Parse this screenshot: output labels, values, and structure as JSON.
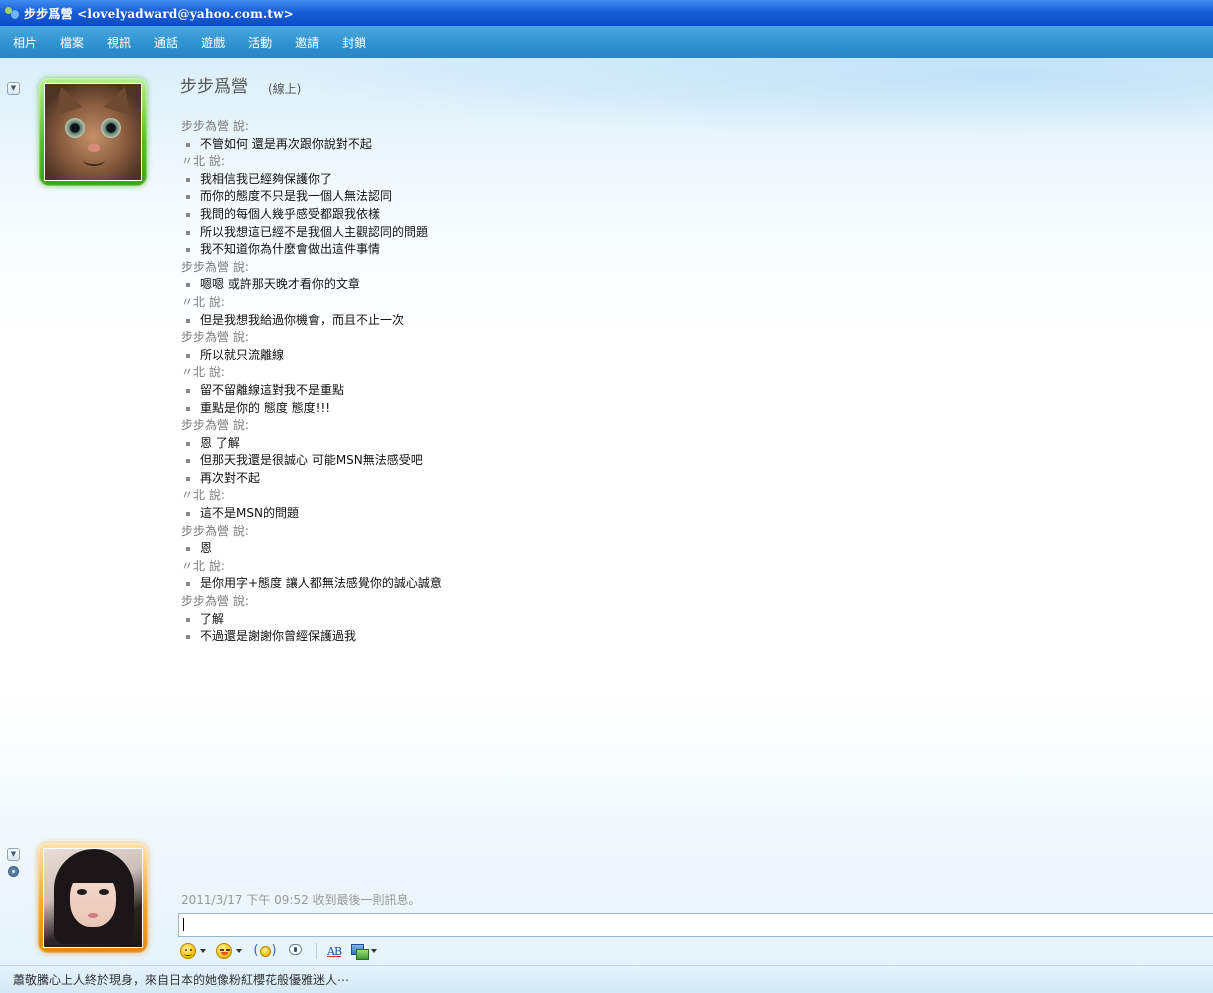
{
  "window": {
    "title": "步步爲營 <lovelyadward@yahoo.com.tw>"
  },
  "menu": [
    "相片",
    "檔案",
    "視訊",
    "通話",
    "遊戲",
    "活動",
    "邀請",
    "封鎖"
  ],
  "contact": {
    "name": "步步爲營",
    "status": "(線上)"
  },
  "conversation": [
    {
      "sender": "步步為營 說:",
      "messages": [
        "不管如何 還是再次跟你說對不起"
      ]
    },
    {
      "sender": "〃北 說:",
      "messages": [
        "我相信我已經夠保護你了",
        "而你的態度不只是我一個人無法認同",
        "我問的每個人幾乎感受都跟我依樣",
        "所以我想這已經不是我個人主觀認同的問題",
        "我不知道你為什麼會做出這件事情"
      ]
    },
    {
      "sender": "步步為營 說:",
      "messages": [
        "嗯嗯 或許那天晚才看你的文章"
      ]
    },
    {
      "sender": "〃北 說:",
      "messages": [
        "但是我想我給過你機會，而且不止一次"
      ]
    },
    {
      "sender": "步步為營 說:",
      "messages": [
        "所以就只流離線"
      ]
    },
    {
      "sender": "〃北 說:",
      "messages": [
        "留不留離線這對我不是重點",
        "重點是你的  態度 態度!!!"
      ]
    },
    {
      "sender": "步步為營 說:",
      "messages": [
        "恩 了解",
        "但那天我還是很誠心 可能MSN無法感受吧",
        "再次對不起"
      ]
    },
    {
      "sender": "〃北 說:",
      "messages": [
        "這不是MSN的問題"
      ]
    },
    {
      "sender": "步步為營 說:",
      "messages": [
        "恩"
      ]
    },
    {
      "sender": "〃北 說:",
      "messages": [
        "是你用字+態度 讓人都無法感覺你的誠心誠意"
      ]
    },
    {
      "sender": "步步為營 說:",
      "messages": [
        "了解",
        "不過還是謝謝你曾經保護過我"
      ]
    }
  ],
  "last_received": "2011/3/17 下午 09:52 收到最後一則訊息。",
  "input": {
    "value": ""
  },
  "statusbar": {
    "text": "蕭敬騰心上人終於現身，來自日本的她像粉紅櫻花般優雅迷人⋯"
  },
  "colors": {
    "titlebar": "#1a5fd6",
    "menubar": "#2e91cf",
    "online_frame": "#4fc01e",
    "self_frame": "#f3a227"
  },
  "icons": {
    "title": "messenger-buddies-icon",
    "collapse": "chevron-down-icon",
    "webcam": "webcam-icon",
    "toolbar": [
      "emoticon-icon",
      "wink-icon",
      "nudge-icon",
      "voice-clip-icon",
      "font-icon",
      "background-icon"
    ]
  }
}
